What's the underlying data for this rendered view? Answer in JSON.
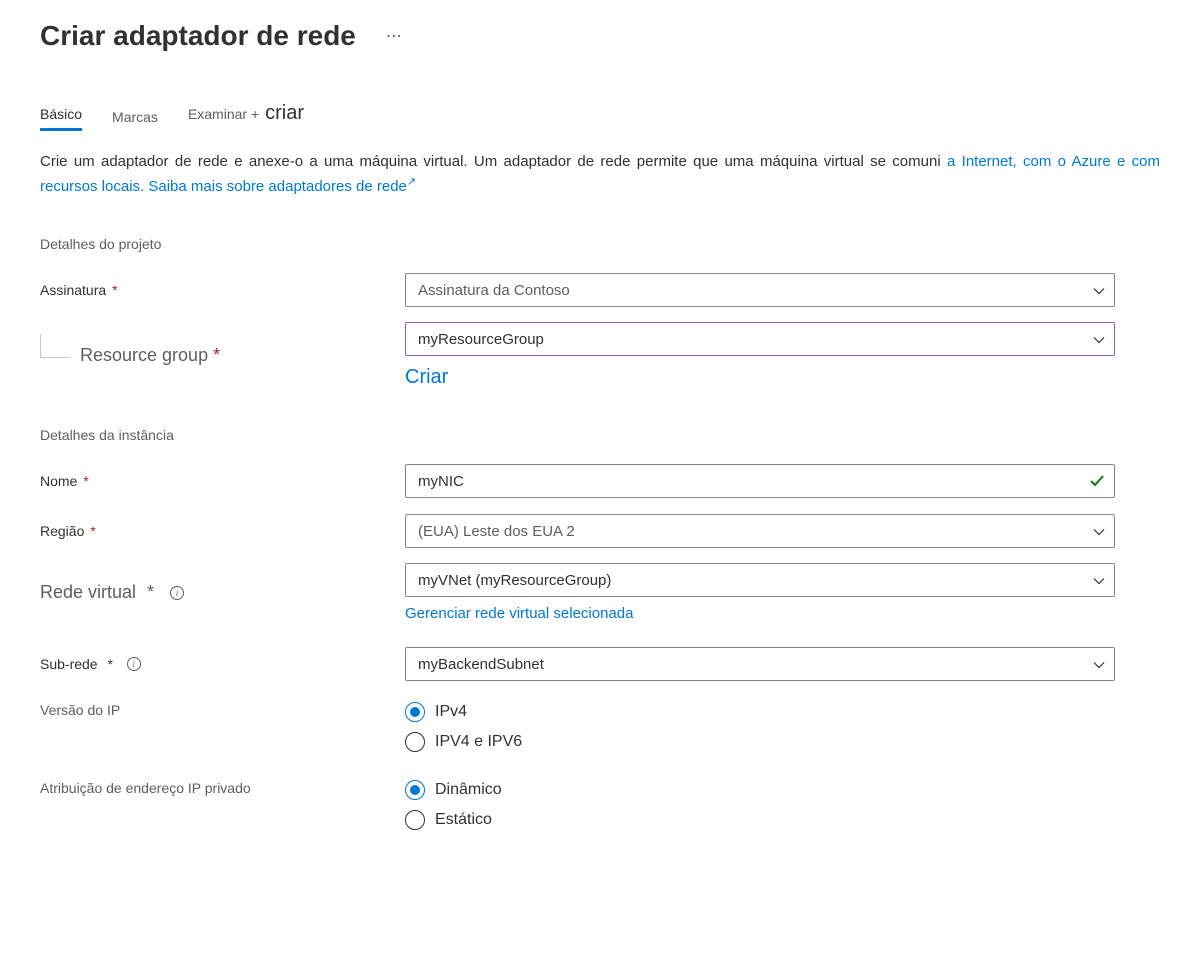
{
  "header": {
    "title": "Criar adaptador de rede"
  },
  "tabs": {
    "basic": "Básico",
    "tags": "Marcas",
    "review_a": "Examinar +",
    "review_b": "criar"
  },
  "intro": {
    "text_a": "Crie um adaptador de rede e anexe-o a uma máquina virtual. Um adaptador de rede permite que uma máquina virtual se comuni",
    "link_a": "a Internet, com o Azure e com recursos locais. ",
    "link_b": "Saiba mais sobre adaptadores de rede"
  },
  "sections": {
    "project": "Detalhes do projeto",
    "instance": "Detalhes da instância"
  },
  "labels": {
    "subscription": "Assinatura",
    "resource_group": "Resource group",
    "create": "Criar",
    "name": "Nome",
    "region": "Região",
    "vnet": "Rede virtual",
    "manage_vnet": "Gerenciar rede virtual selecionada",
    "subnet": "Sub-rede",
    "ip_version": "Versão do IP",
    "ip_assignment": "Atribuição de endereço IP privado"
  },
  "values": {
    "subscription": "Assinatura da Contoso",
    "resource_group": "myResourceGroup",
    "name": "myNIC",
    "region": "(EUA) Leste dos EUA 2",
    "vnet": "myVNet (myResourceGroup)",
    "subnet": "myBackendSubnet"
  },
  "radios": {
    "ipv4": "IPv4",
    "ipv4_ipv6": "IPV4 e IPV6",
    "dynamic": "Dinâmico",
    "static": "Estático"
  }
}
